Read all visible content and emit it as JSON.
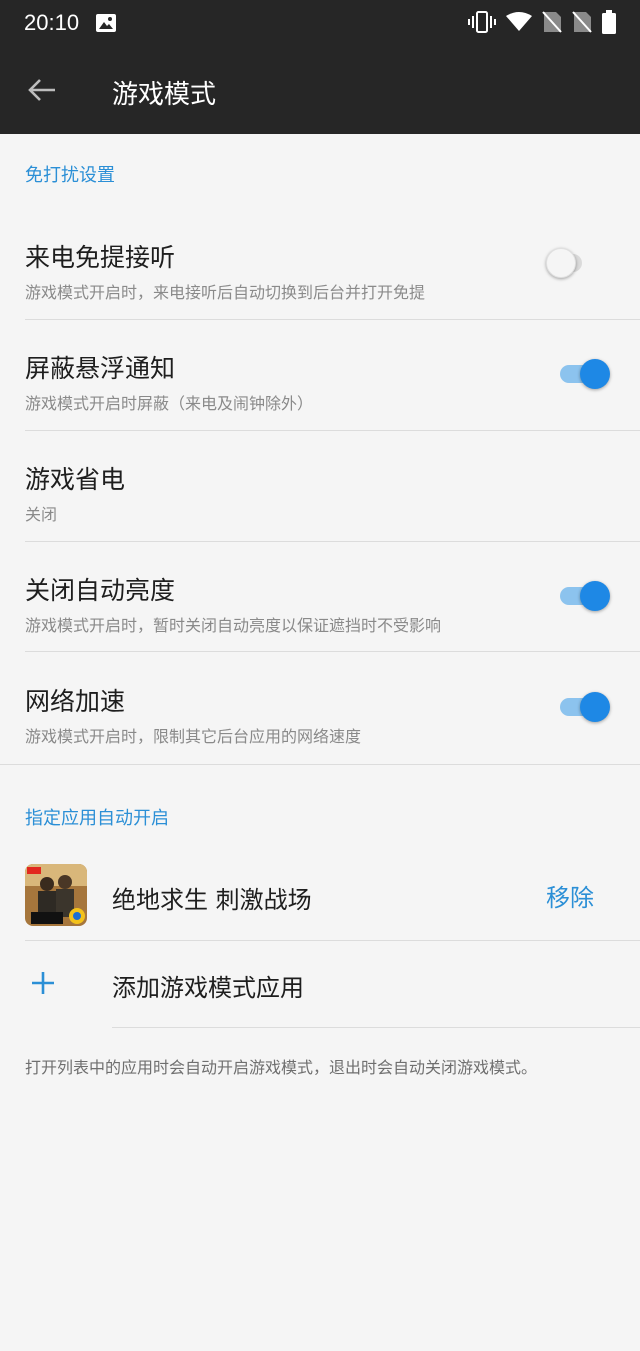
{
  "status_bar": {
    "time": "20:10",
    "icons": [
      "image-icon",
      "vibrate-icon",
      "wifi-icon",
      "no-sim-icon",
      "no-sim-icon",
      "battery-icon"
    ]
  },
  "app_bar": {
    "title": "游戏模式"
  },
  "sections": {
    "dnd_header": "免打扰设置",
    "apps_header": "指定应用自动开启"
  },
  "settings": [
    {
      "title": "来电免提接听",
      "subtitle": "游戏模式开启时，来电接听后自动切换到后台并打开免提",
      "toggle": false
    },
    {
      "title": "屏蔽悬浮通知",
      "subtitle": "游戏模式开启时屏蔽（来电及闹钟除外）",
      "toggle": true
    },
    {
      "title": "游戏省电",
      "subtitle": "关闭"
    },
    {
      "title": "关闭自动亮度",
      "subtitle": "游戏模式开启时，暂时关闭自动亮度以保证遮挡时不受影响",
      "toggle": true
    },
    {
      "title": "网络加速",
      "subtitle": "游戏模式开启时，限制其它后台应用的网络速度",
      "toggle": true
    }
  ],
  "apps": [
    {
      "name": "绝地求生 刺激战场",
      "action": "移除"
    }
  ],
  "add_app_label": "添加游戏模式应用",
  "footer_note": "打开列表中的应用时会自动开启游戏模式，退出时会自动关闭游戏模式。",
  "colors": {
    "accent": "#2b8fd6",
    "switch_on": "#1e88e5",
    "app_bar": "#262626"
  }
}
